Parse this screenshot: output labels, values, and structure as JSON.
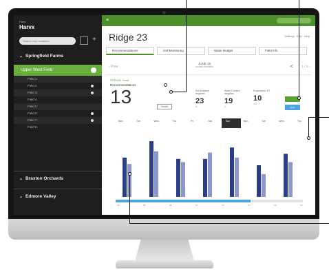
{
  "sidebar": {
    "brand": "Harvx",
    "brand_small": "Farm",
    "search_placeholder": "Search crop locations",
    "group1": "Springfield Farms",
    "active_item": "Upper West Field",
    "sub_items": [
      "Field 1",
      "Field 2",
      "Field 3",
      "Field 4",
      "Field 5",
      "Field 6",
      "Field 7",
      "Field 8"
    ],
    "group2": "Braxton Orchards",
    "group3": "Edmore Valley"
  },
  "main": {
    "title": "Ridge 23",
    "top_actions": "Settings  ·  Edit  ·  Help",
    "tabs": [
      "Recommendations",
      "Soil Monitoring",
      "Water Budget",
      "Field Info"
    ],
    "ribbon_nav": "‹ Prev",
    "ribbon_date": "JUNE 18",
    "ribbon_date_sub": "Update available",
    "ribbon_pager": "1 / 3 ›",
    "status_label": "STATUS: Good",
    "rec_label": "Recommendations",
    "big_number": "13",
    "mini_button": "Details",
    "stats": [
      {
        "label": "Soil Moisture Irrigation",
        "value": "23",
        "unit": "%"
      },
      {
        "label": "Water Content Irrigation",
        "value": "19",
        "unit": "%"
      },
      {
        "label": "Evapotrans. ET",
        "value": "10",
        "unit": "mm"
      }
    ],
    "blue_button": "Apply",
    "days": [
      "Mon",
      "Tue",
      "Wed",
      "Thu",
      "Fri",
      "Sat",
      "Sun",
      "Mon",
      "Tue",
      "Wed",
      "Thu"
    ]
  },
  "chart_data": {
    "type": "bar",
    "categories": [
      "1",
      "2",
      "3",
      "4",
      "5",
      "6",
      "7"
    ],
    "series": [
      {
        "name": "",
        "values": [
          62,
          88,
          60,
          60,
          78,
          50,
          68
        ]
      },
      {
        "name": "",
        "values": [
          52,
          72,
          55,
          70,
          62,
          36,
          55
        ]
      }
    ],
    "x_labels": [
      "04",
      "06",
      "08",
      "10",
      "12",
      "14",
      "16",
      "18"
    ],
    "colors": [
      "#2b3e8a",
      "#8c97cd"
    ],
    "scroll_progress": 0.72
  }
}
